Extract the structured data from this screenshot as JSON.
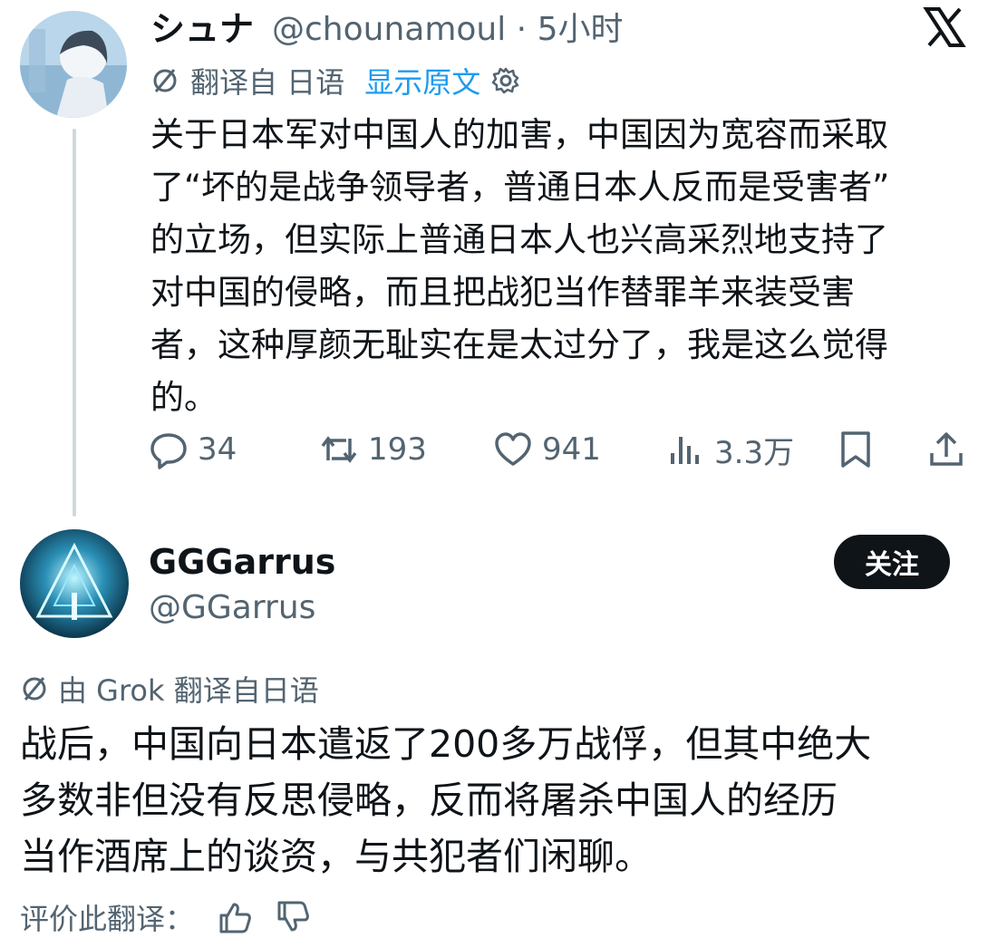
{
  "tweet1": {
    "display_name": "シュナ",
    "handle_time": "@chounamoul · 5小时",
    "translate_label": "翻译自 日语",
    "show_original": "显示原文",
    "body": "关于日本军对中国人的加害，中国因为宽容而采取\n了“坏的是战争领导者，普通日本人反而是受害者”\n的立场，但实际上普通日本人也兴高采烈地支持了\n对中国的侵略，而且把战犯当作替罪羊来装受害\n者，这种厚颜无耻实在是太过分了，我是这么觉得\n的。",
    "replies": "34",
    "reposts": "193",
    "likes": "941",
    "views": "3.3万"
  },
  "tweet2": {
    "display_name": "GGGarrus",
    "handle": "@GGarrus",
    "follow_label": "关注",
    "grok_label": "由 Grok 翻译自日语",
    "body": "战后，中国向日本遣返了200多万战俘，但其中绝大\n多数非但没有反思侵略，反而将屠杀中国人的经历\n当作酒席上的谈资，与共犯者们闲聊。",
    "rate_label": "评价此翻译："
  },
  "colors": {
    "text": "#0f1419",
    "secondary": "#536471",
    "link": "#1d9bf0",
    "thread_line": "#cfd9de"
  },
  "icons": [
    "x-logo-icon",
    "translate-icon",
    "gear-icon",
    "reply-icon",
    "repost-icon",
    "like-icon",
    "views-icon",
    "bookmark-icon",
    "share-icon",
    "thumbs-up-icon",
    "thumbs-down-icon"
  ]
}
